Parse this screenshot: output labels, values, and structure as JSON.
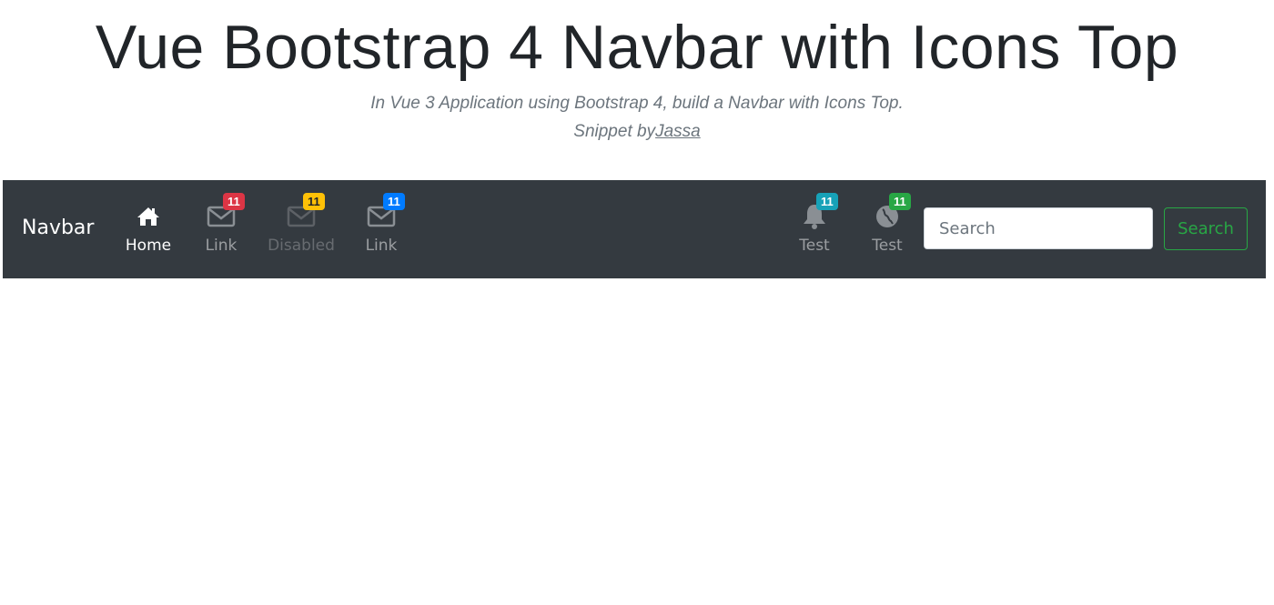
{
  "header": {
    "title": "Vue Bootstrap 4 Navbar with Icons Top",
    "subtitle": "In Vue 3 Application using Bootstrap 4, build a Navbar with Icons Top.",
    "credit_prefix": "Snippet by",
    "credit_link": "Jassa"
  },
  "navbar": {
    "brand": "Navbar",
    "items": [
      {
        "label": "Home",
        "icon": "home-icon",
        "state": "active"
      },
      {
        "label": "Link",
        "icon": "envelope-icon",
        "badge": "11",
        "badge_color": "#dc3545"
      },
      {
        "label": "Disabled",
        "icon": "envelope-icon",
        "badge": "11",
        "badge_color": "#ffc107",
        "state": "disabled"
      },
      {
        "label": "Link",
        "icon": "envelope-icon",
        "badge": "11",
        "badge_color": "#007bff"
      }
    ],
    "right_items": [
      {
        "label": "Test",
        "icon": "bell-icon",
        "badge": "11",
        "badge_color": "#17a2b8"
      },
      {
        "label": "Test",
        "icon": "globe-icon",
        "badge": "11",
        "badge_color": "#28a745"
      }
    ],
    "search": {
      "placeholder": "Search",
      "value": "",
      "button_label": "Search"
    }
  },
  "colors": {
    "navbar_bg": "#343a40",
    "success": "#28a745"
  }
}
